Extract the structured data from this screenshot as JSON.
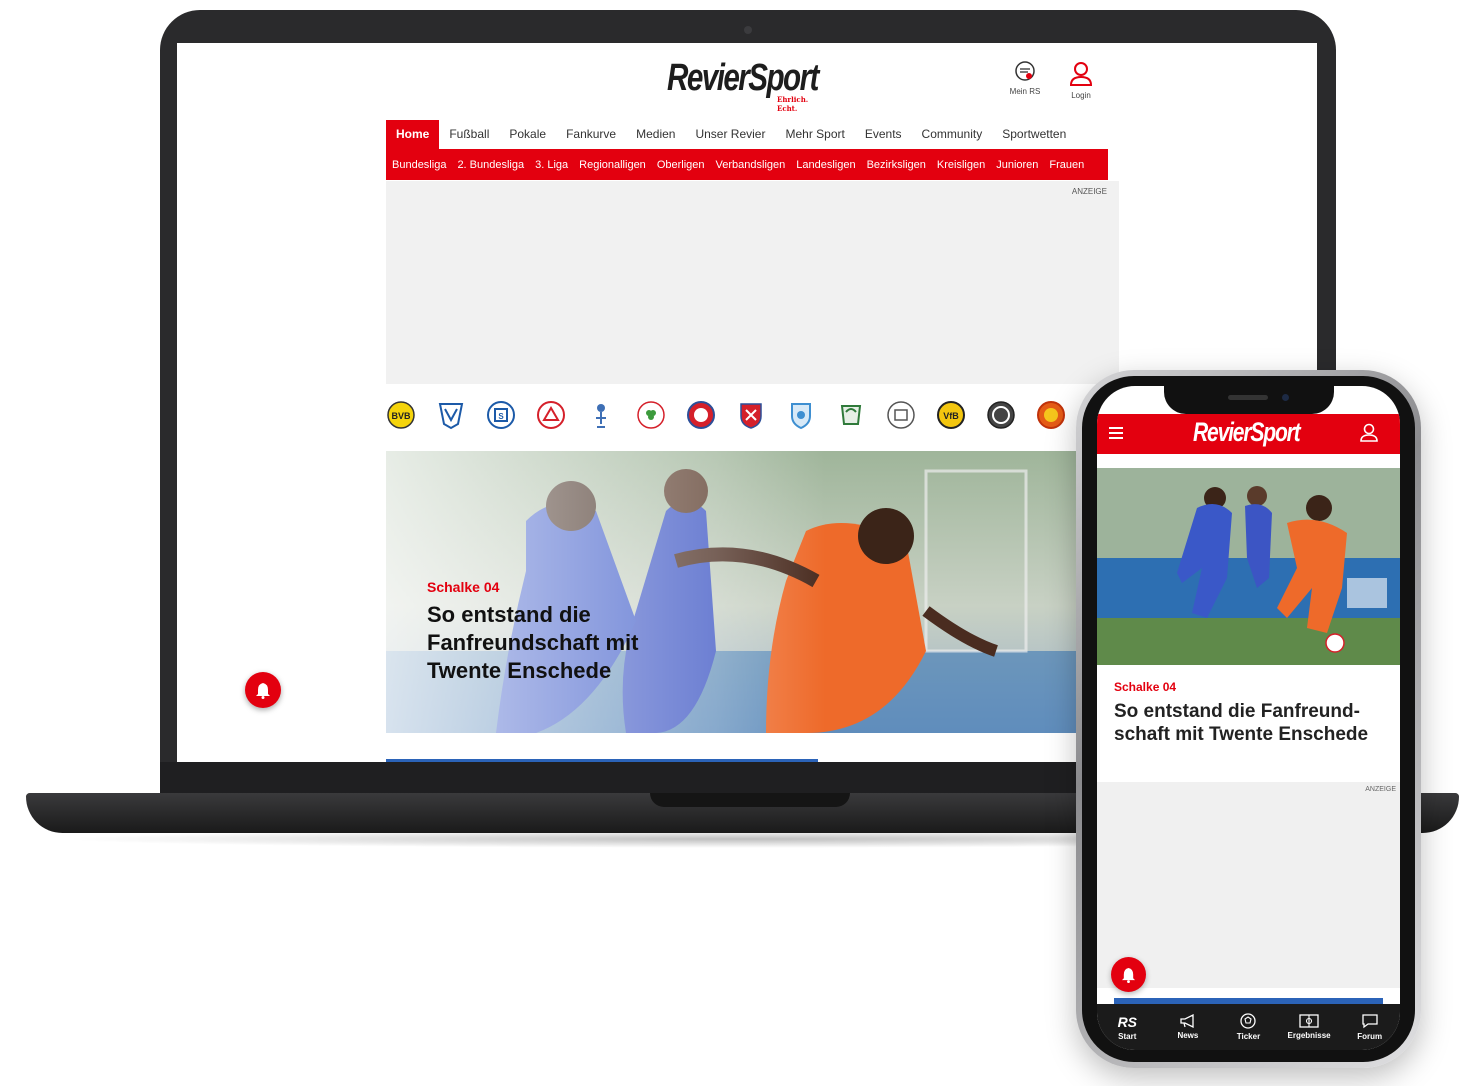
{
  "desktop": {
    "logo": {
      "word": "RevierSport",
      "tagline": "Ehrlich. Echt."
    },
    "utility": {
      "mein_rs": "Mein RS",
      "login": "Login"
    },
    "nav": [
      "Home",
      "Fußball",
      "Pokale",
      "Fankurve",
      "Medien",
      "Unser Revier",
      "Mehr Sport",
      "Events",
      "Community",
      "Sportwetten"
    ],
    "subnav": [
      "Bundesliga",
      "2. Bundesliga",
      "3. Liga",
      "Regionalligen",
      "Oberligen",
      "Verbandsligen",
      "Landesligen",
      "Bezirksligen",
      "Kreisligen",
      "Junioren",
      "Frauen"
    ],
    "ad_label": "ANZEIGE",
    "hero": {
      "kicker": "Schalke 04",
      "headline": "So entstand die Fanfreundschaft mit Twente Enschede"
    }
  },
  "mobile": {
    "logo": "RevierSport",
    "article": {
      "kicker": "Schalke 04",
      "headline": "So entstand die Fanfreund-schaft mit Twente Enschede"
    },
    "ad_label": "ANZEIGE",
    "tabs": {
      "start_mark": "RS",
      "start": "Start",
      "news": "News",
      "ticker": "Ticker",
      "ergebnisse": "Ergebnisse",
      "forum": "Forum"
    }
  },
  "colors": {
    "brand_red": "#e3000f",
    "dark": "#1b1b1b",
    "ad_gray": "#f1f1f1"
  },
  "icons": [
    "bell-icon",
    "user-icon",
    "menu-icon",
    "megaphone-icon",
    "ball-icon",
    "pitch-icon",
    "chat-icon",
    "mein-rs-icon"
  ]
}
